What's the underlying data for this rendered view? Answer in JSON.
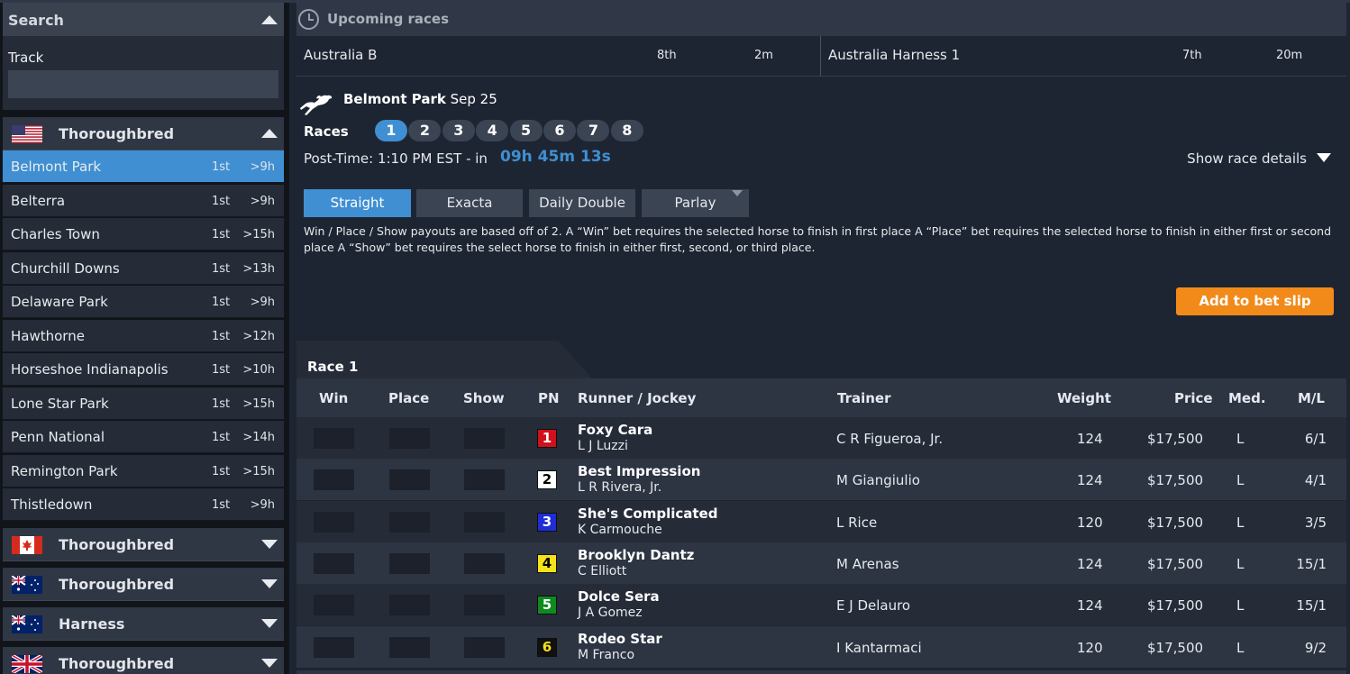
{
  "sidebar": {
    "search_label": "Search",
    "track_label": "Track",
    "track_input_value": "",
    "groups": [
      {
        "flag": "us-flag",
        "name": "Thoroughbred",
        "expanded": true
      },
      {
        "flag": "canada-flag",
        "name": "Thoroughbred",
        "expanded": false
      },
      {
        "flag": "australia-flag",
        "name": "Thoroughbred",
        "expanded": false
      },
      {
        "flag": "australia-flag",
        "name": "Harness",
        "expanded": false
      },
      {
        "flag": "uk-flag",
        "name": "Thoroughbred",
        "expanded": false
      }
    ],
    "tracks": [
      {
        "name": "Belmont Park",
        "race": "1st",
        "time": ">9h",
        "active": true
      },
      {
        "name": "Belterra",
        "race": "1st",
        "time": ">9h"
      },
      {
        "name": "Charles Town",
        "race": "1st",
        "time": ">15h"
      },
      {
        "name": "Churchill Downs",
        "race": "1st",
        "time": ">13h"
      },
      {
        "name": "Delaware Park",
        "race": "1st",
        "time": ">9h"
      },
      {
        "name": "Hawthorne",
        "race": "1st",
        "time": ">12h"
      },
      {
        "name": "Horseshoe Indianapolis",
        "race": "1st",
        "time": ">10h"
      },
      {
        "name": "Lone Star Park",
        "race": "1st",
        "time": ">15h"
      },
      {
        "name": "Penn National",
        "race": "1st",
        "time": ">14h"
      },
      {
        "name": "Remington Park",
        "race": "1st",
        "time": ">15h"
      },
      {
        "name": "Thistledown",
        "race": "1st",
        "time": ">9h"
      }
    ]
  },
  "upcoming": {
    "title": "Upcoming races",
    "items": [
      {
        "name": "Australia B",
        "race": "8th",
        "time": "2m"
      },
      {
        "name": "Australia Harness 1",
        "race": "7th",
        "time": "20m"
      }
    ]
  },
  "track": {
    "name": "Belmont Park",
    "date": "Sep 25",
    "races_label": "Races",
    "races": [
      "1",
      "2",
      "3",
      "4",
      "5",
      "6",
      "7",
      "8"
    ],
    "selected_race": "1",
    "post_time_text": "Post-Time: 1:10 PM EST - in",
    "countdown": "09h 45m 13s",
    "show_details": "Show race details"
  },
  "bet_types": [
    {
      "label": "Straight",
      "active": true
    },
    {
      "label": "Exacta"
    },
    {
      "label": "Daily Double"
    },
    {
      "label": "Parlay",
      "has_dropdown": true
    }
  ],
  "description": "Win / Place / Show payouts are based off of 2. A “Win” bet requires the selected horse to finish in first place A “Place” bet requires the selected horse to finish in either first or second place A “Show” bet requires the select horse to finish in either first, second, or third place.",
  "add_to_slip": "Add to bet slip",
  "race_table": {
    "race_title": "Race 1",
    "headers": {
      "win": "Win",
      "place": "Place",
      "show": "Show",
      "pn": "PN",
      "runner": "Runner / Jockey",
      "trainer": "Trainer",
      "weight": "Weight",
      "price": "Price",
      "med": "Med.",
      "ml": "M/L"
    },
    "rows": [
      {
        "pn": "1",
        "pn_bg": "#d0111b",
        "pn_fg": "#ffffff",
        "runner": "Foxy Cara",
        "jockey": "L J Luzzi",
        "trainer": "C R Figueroa, Jr.",
        "weight": "124",
        "price": "$17,500",
        "med": "L",
        "ml": "6/1"
      },
      {
        "pn": "2",
        "pn_bg": "#ffffff",
        "pn_fg": "#000000",
        "runner": "Best Impression",
        "jockey": "L R Rivera, Jr.",
        "trainer": "M Giangiulio",
        "weight": "124",
        "price": "$17,500",
        "med": "L",
        "ml": "4/1"
      },
      {
        "pn": "3",
        "pn_bg": "#1f2dd6",
        "pn_fg": "#ffffff",
        "runner": "She's Complicated",
        "jockey": "K Carmouche",
        "trainer": "L Rice",
        "weight": "120",
        "price": "$17,500",
        "med": "L",
        "ml": "3/5"
      },
      {
        "pn": "4",
        "pn_bg": "#f5e21b",
        "pn_fg": "#000000",
        "runner": "Brooklyn Dantz",
        "jockey": "C Elliott",
        "trainer": "M Arenas",
        "weight": "124",
        "price": "$17,500",
        "med": "L",
        "ml": "15/1"
      },
      {
        "pn": "5",
        "pn_bg": "#0f8a1e",
        "pn_fg": "#ffffff",
        "runner": "Dolce Sera",
        "jockey": "J A Gomez",
        "trainer": "E J Delauro",
        "weight": "124",
        "price": "$17,500",
        "med": "L",
        "ml": "15/1"
      },
      {
        "pn": "6",
        "pn_bg": "#111111",
        "pn_fg": "#f5e21b",
        "runner": "Rodeo Star",
        "jockey": "M Franco",
        "trainer": "I Kantarmaci",
        "weight": "120",
        "price": "$17,500",
        "med": "L",
        "ml": "9/2"
      }
    ]
  },
  "colors": {
    "accent": "#3f8fd2",
    "cta": "#f28a1a"
  }
}
